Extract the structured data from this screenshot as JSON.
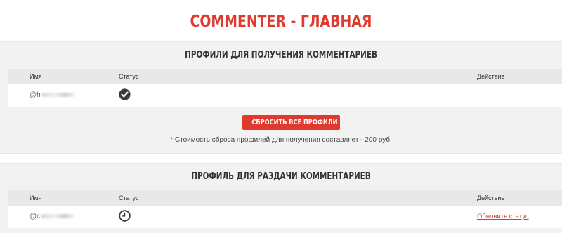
{
  "app": {
    "title": "COMMENTER - ГЛАВНАЯ"
  },
  "receiving_profiles": {
    "title": "ПРОФИЛИ ДЛЯ ПОЛУЧЕНИЯ КОММЕНТАРИЕВ",
    "columns": [
      "Имя",
      "Статус",
      "Действие"
    ],
    "rows": [
      {
        "username": "@h",
        "status_icon": "check-circle-icon",
        "action": ""
      }
    ],
    "reset_button": "СБРОСИТЬ ВСЕ ПРОФИЛИ",
    "cost_note_asterisk": "*",
    "cost_note": "Стоимость сброса профилей для получения составляет - 200 руб."
  },
  "giving_profile": {
    "title": "ПРОФИЛЬ ДЛЯ РАЗДАЧИ КОММЕНТАРИЕВ",
    "columns": [
      "Имя",
      "Статус",
      "Действие"
    ],
    "rows": [
      {
        "username": "@c",
        "status_icon": "clock-icon",
        "action": "Обновить статус"
      }
    ]
  },
  "colors": {
    "accent": "#e03a2f",
    "panel_bg": "#f2f2f2",
    "header_bg": "#e8e8e8"
  }
}
